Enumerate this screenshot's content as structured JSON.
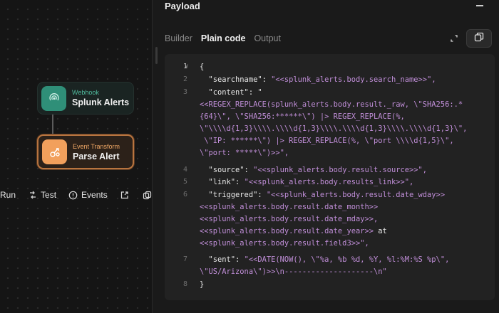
{
  "canvas": {
    "nodes": [
      {
        "kind": "Webhook",
        "name": "Splunk Alerts",
        "icon": "webhook-icon",
        "accent": "#2f8f78"
      },
      {
        "kind": "Event Transform",
        "name": "Parse Alert",
        "icon": "transform-icon",
        "accent": "#f2a05c"
      }
    ],
    "toolbar": {
      "run_label": "Run",
      "test_label": "Test",
      "events_label": "Events"
    }
  },
  "panel": {
    "title": "Payload",
    "tabs": [
      "Builder",
      "Plain code",
      "Output"
    ],
    "active_tab": "Plain code",
    "code": {
      "line_numbers": [
        "1",
        "2",
        "3",
        "4",
        "5",
        "6",
        "7",
        "8"
      ],
      "fold_marker": "∨",
      "open_brace": "{",
      "close_brace": "}",
      "searchname_key": "\"searchname\": ",
      "searchname_value": "\"<<splunk_alerts.body.search_name>>\",",
      "content_key": "\"content\": \"",
      "content_lines": [
        "<<REGEX_REPLACE(splunk_alerts.body.result._raw, \\\"SHA256:.*",
        "{64}\\\", \\\"SHA256:******\\\") |> REGEX_REPLACE(%,",
        "\\\"\\\\\\\\d{1,3}\\\\\\\\.\\\\\\\\d{1,3}\\\\\\\\.\\\\\\\\d{1,3}\\\\\\\\.\\\\\\\\d{1,3}\\\",",
        " \\\"IP: ******\\\") |> REGEX_REPLACE(%, \\\"port \\\\\\\\d{1,5}\\\",",
        "\\\"port: *****\\\")>>\","
      ],
      "source_key": "\"source\": ",
      "source_value": "\"<<splunk_alerts.body.result.source>>\",",
      "link_key": "\"link\": ",
      "link_value": "\"<<splunk_alerts.body.results_link>>\",",
      "triggered_key": "\"triggered\": ",
      "triggered_lines": [
        "\"<<splunk_alerts.body.result.date_wday>>",
        "<<splunk_alerts.body.result.date_month>>",
        "<<splunk_alerts.body.result.date_mday>>,",
        "<<splunk_alerts.body.result.date_year>>",
        "<<splunk_alerts.body.result.field3>>\","
      ],
      "triggered_at": " at",
      "sent_key": "\"sent\": ",
      "sent_lines": [
        "\"<<DATE(NOW(), \\\"%a, %b %d, %Y, %l:%M:%S %p\\\",",
        "\\\"US/Arizona\\\")>>\\n--------------------\\n\""
      ]
    }
  }
}
